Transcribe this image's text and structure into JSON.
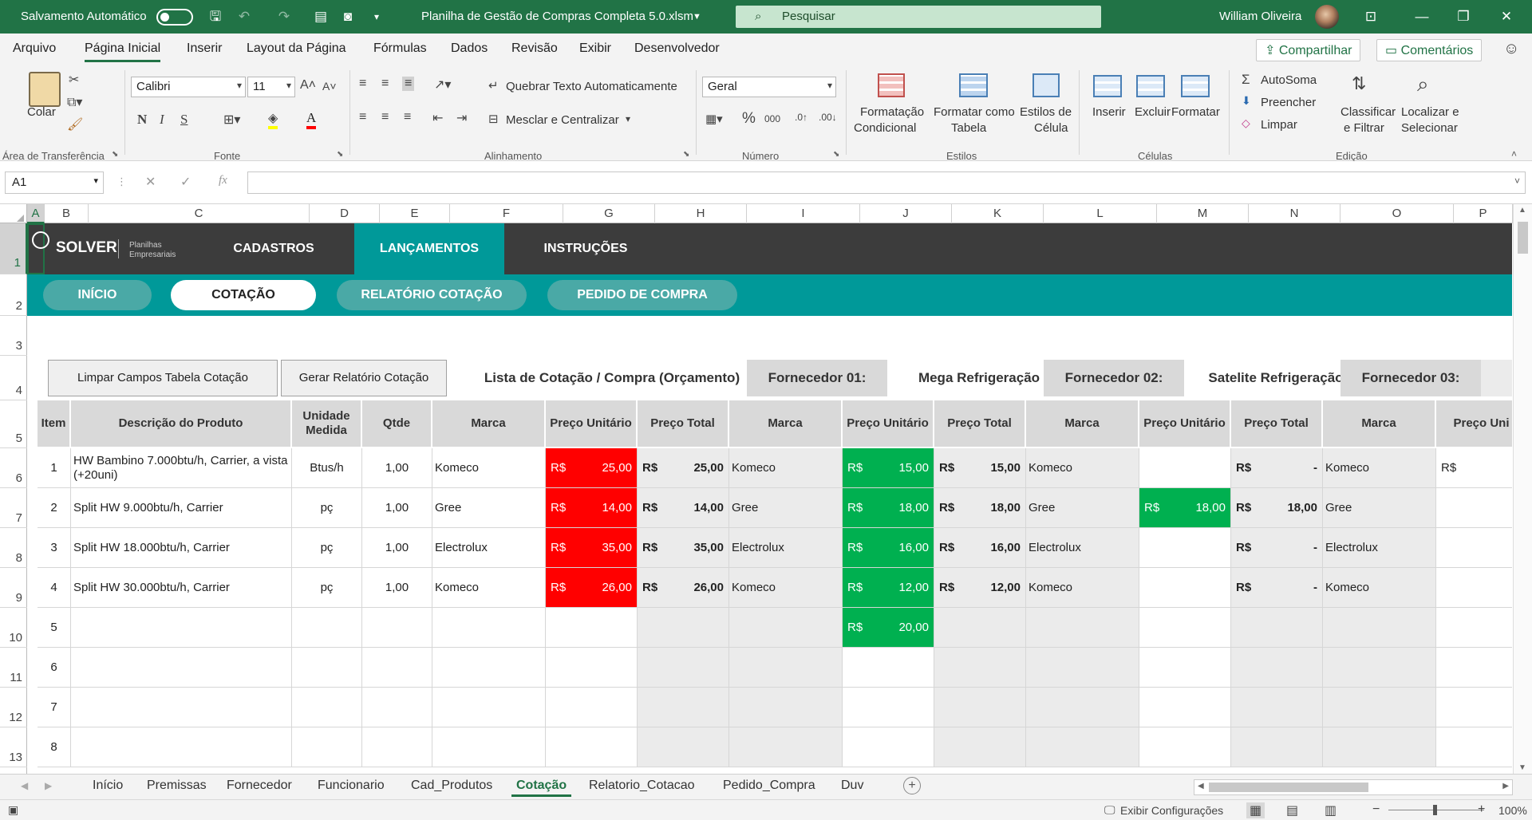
{
  "titlebar": {
    "autosave": "Salvamento Automático",
    "filename": "Planilha de Gestão de Compras Completa 5.0.xlsm",
    "search_placeholder": "Pesquisar",
    "user": "William Oliveira"
  },
  "menu": {
    "tabs": [
      "Arquivo",
      "Página Inicial",
      "Inserir",
      "Layout da Página",
      "Fórmulas",
      "Dados",
      "Revisão",
      "Exibir",
      "Desenvolvedor"
    ],
    "share": "Compartilhar",
    "comments": "Comentários"
  },
  "ribbon": {
    "paste": "Colar",
    "clipboard": "Área de Transferência",
    "font_name": "Calibri",
    "font_size": "11",
    "font_group": "Fonte",
    "bold": "N",
    "italic": "I",
    "underline": "S",
    "wrap": "Quebrar Texto Automaticamente",
    "merge": "Mesclar e Centralizar",
    "align_group": "Alinhamento",
    "number_format": "Geral",
    "number_group": "Número",
    "cond1": "Formatação",
    "cond2": "Condicional",
    "fmt_table1": "Formatar como",
    "fmt_table2": "Tabela",
    "cell_styles1": "Estilos de",
    "cell_styles2": "Célula",
    "styles_group": "Estilos",
    "insert": "Inserir",
    "delete": "Excluir",
    "format": "Formatar",
    "cells_group": "Células",
    "autosum": "AutoSoma",
    "fill": "Preencher",
    "clear": "Limpar",
    "sort1": "Classificar",
    "sort2": "e Filtrar",
    "find1": "Localizar e",
    "find2": "Selecionar",
    "edit_group": "Edição"
  },
  "formula_bar": {
    "name_box": "A1",
    "fx": "fx",
    "formula": ""
  },
  "columns": [
    "A",
    "B",
    "C",
    "D",
    "E",
    "F",
    "G",
    "H",
    "I",
    "J",
    "K",
    "L",
    "M",
    "N",
    "O",
    "P"
  ],
  "rows": [
    "1",
    "2",
    "3",
    "4",
    "5",
    "6",
    "7",
    "8",
    "9",
    "10",
    "11",
    "12",
    "13"
  ],
  "banner": {
    "logo": "SOLVER",
    "logo_sub1": "Planilhas",
    "logo_sub2": "Empresariais",
    "nav": [
      "CADASTROS",
      "LANÇAMENTOS",
      "INSTRUÇÕES"
    ],
    "pills": [
      "INÍCIO",
      "COTAÇÃO",
      "RELATÓRIO COTAÇÃO",
      "PEDIDO DE COMPRA"
    ]
  },
  "actions": {
    "clear": "Limpar Campos Tabela Cotação",
    "report": "Gerar Relatório Cotação",
    "list_title": "Lista de Cotação / Compra (Orçamento)"
  },
  "suppliers": [
    {
      "label": "Fornecedor 01:",
      "name": "Mega Refrigeração"
    },
    {
      "label": "Fornecedor 02:",
      "name": "Satelite Refrigeração"
    },
    {
      "label": "Fornecedor 03:",
      "name": ""
    }
  ],
  "headers": {
    "item": "Item",
    "desc": "Descrição do Produto",
    "unit": "Unidade Medida",
    "qty": "Qtde",
    "brand": "Marca",
    "unit_price": "Preço Unitário",
    "total": "Preço Total",
    "unit_price_cut": "Preço Uni"
  },
  "currency": "R$",
  "dash": "-",
  "table": [
    {
      "item": "1",
      "desc": "HW Bambino 7.000btu/h, Carrier, a vista (+20uni)",
      "unit": "Btus/h",
      "qty": "1,00",
      "brand": "Komeco",
      "p0": "25,00",
      "t0": "25,00",
      "b1": "Komeco",
      "p1": "15,00",
      "t1": "15,00",
      "b2": "Komeco",
      "p2": "",
      "t2": "-",
      "b3": "Komeco"
    },
    {
      "item": "2",
      "desc": "Split HW  9.000btu/h, Carrier",
      "unit": "pç",
      "qty": "1,00",
      "brand": "Gree",
      "p0": "14,00",
      "t0": "14,00",
      "b1": "Gree",
      "p1": "18,00",
      "t1": "18,00",
      "b2": "Gree",
      "p2": "18,00",
      "t2": "18,00",
      "b3": "Gree"
    },
    {
      "item": "3",
      "desc": "Split HW 18.000btu/h, Carrier",
      "unit": "pç",
      "qty": "1,00",
      "brand": "Electrolux",
      "p0": "35,00",
      "t0": "35,00",
      "b1": "Electrolux",
      "p1": "16,00",
      "t1": "16,00",
      "b2": "Electrolux",
      "p2": "",
      "t2": "-",
      "b3": "Electrolux"
    },
    {
      "item": "4",
      "desc": "Split HW 30.000btu/h, Carrier",
      "unit": "pç",
      "qty": "1,00",
      "brand": "Komeco",
      "p0": "26,00",
      "t0": "26,00",
      "b1": "Komeco",
      "p1": "12,00",
      "t1": "12,00",
      "b2": "Komeco",
      "p2": "",
      "t2": "-",
      "b3": "Komeco"
    },
    {
      "item": "5",
      "p1": "20,00"
    },
    {
      "item": "6"
    },
    {
      "item": "7"
    },
    {
      "item": "8"
    }
  ],
  "sheets": [
    "Início",
    "Premissas",
    "Fornecedor",
    "Funcionario",
    "Cad_Produtos",
    "Cotação",
    "Relatorio_Cotacao",
    "Pedido_Compra",
    "Duv"
  ],
  "status": {
    "settings": "Exibir Configurações",
    "zoom": "100%"
  }
}
